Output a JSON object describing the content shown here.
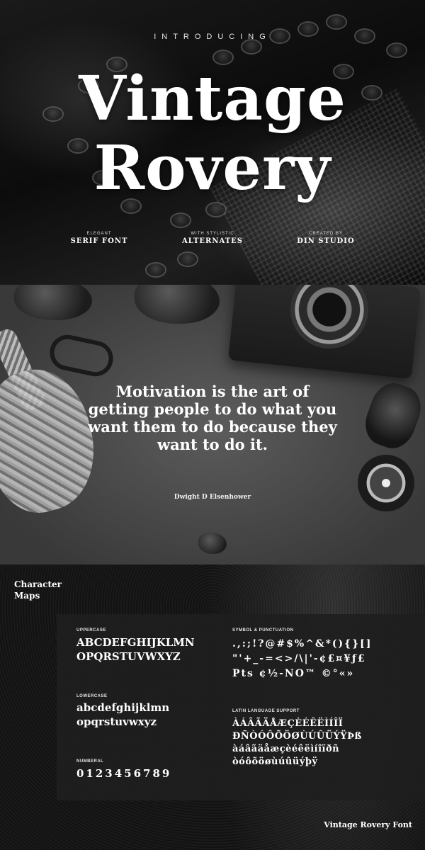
{
  "hero": {
    "intro": "INTRODUCING",
    "title_line1": "Vintage",
    "title_line2": "Rovery",
    "features": [
      {
        "small": "ELEGANT",
        "big": "SERIF FONT"
      },
      {
        "small": "WITH STYLISTIC",
        "big": "ALTERNATES"
      },
      {
        "small": "CREATED BY",
        "big": "DIN STUDIO"
      }
    ]
  },
  "quote": {
    "text": "Motivation is the art of getting people to do what you want them to do because they want to do it.",
    "author": "Dwight D Elsenhower"
  },
  "maps": {
    "heading_line1": "Character",
    "heading_line2": "Maps",
    "uppercase": {
      "label": "UPPERCASE",
      "line1": "ABCDEFGHIJKLMN",
      "line2": "OPQRSTUVWXYZ"
    },
    "lowercase": {
      "label": "LOWERCASE",
      "line1": "abcdefghijklmn",
      "line2": "opqrstuvwxyz"
    },
    "numberal": {
      "label": "NUMBERAL",
      "line1": "0123456789"
    },
    "symbols": {
      "label": "SYMBOL & PUNCTUATION",
      "line1": ".,:;!?@#$%^&*(){}[]",
      "line2": "\"'+_-=<>/\\|'-¢£¤¥ƒ£",
      "line3": "Pts ¢½-NO™ ©°«»"
    },
    "latin": {
      "label": "LATIN LANGUAGE SUPPORT",
      "line1": "ÀÁÂÃÄÅÆÇÈÉÊËÌÍÎÏ",
      "line2": "ÐÑÒÓÔÕÖØÙÚÛÜÝŸÞß",
      "line3": "àáâãäåæçèéêëìíîïðñ",
      "line4": "òóôõöøùúûüýþÿ"
    },
    "footer": "Vintage Rovery Font"
  }
}
